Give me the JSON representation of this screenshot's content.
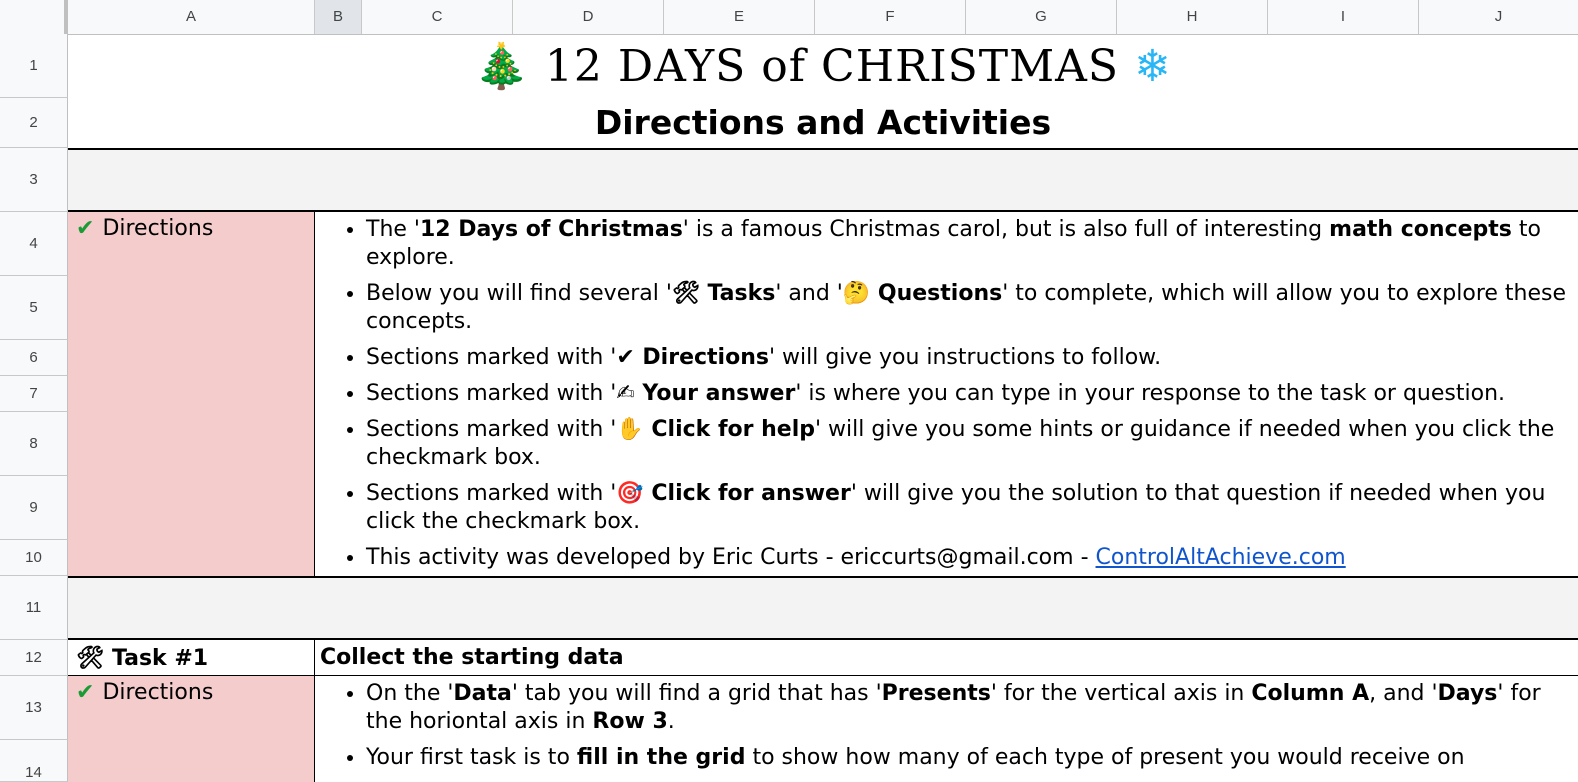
{
  "columns": [
    "A",
    "B",
    "C",
    "D",
    "E",
    "F",
    "G",
    "H",
    "I",
    "J"
  ],
  "rows": [
    "1",
    "2",
    "3",
    "4",
    "5",
    "6",
    "7",
    "8",
    "9",
    "10",
    "11",
    "12",
    "13",
    "14"
  ],
  "title": "12 DAYS of CHRISTMAS",
  "title_icon_left": "🎄",
  "title_icon_right": "❄",
  "subtitle": "Directions and Activities",
  "directions_label": "Directions",
  "check_glyph": "✔",
  "tools_glyph": "🛠",
  "directions_items": [
    {
      "parts": [
        "The '",
        "12 Days of Christmas",
        "' is a famous Christmas carol, but is also full of interesting ",
        "math concepts",
        " to explore."
      ]
    },
    {
      "parts": [
        "Below you will find several '",
        "🛠 Tasks",
        "' and '",
        "🤔 Questions",
        "' to complete, which will allow you to explore these concepts."
      ]
    },
    {
      "parts": [
        "Sections marked with '",
        "✔ Directions",
        "' will give you instructions to follow."
      ]
    },
    {
      "parts": [
        "Sections marked with '",
        "✍ Your answer",
        "' is where you can type in your response to the task or question."
      ]
    },
    {
      "parts": [
        "Sections marked with '",
        "✋ Click for help",
        "' will give you some hints or guidance if needed when you click the checkmark box."
      ]
    },
    {
      "parts": [
        "Sections marked with '",
        "🎯 Click for answer",
        "' will give you the solution to that question if needed when you click the checkmark box."
      ]
    },
    {
      "parts": [
        "This activity was developed by Eric Curts - ericcurts@gmail.com - ",
        "ControlAltAchieve.com"
      ]
    }
  ],
  "task1": {
    "label": "Task #1",
    "title": "Collect the starting data",
    "directions_label": "Directions",
    "items": [
      {
        "parts": [
          "On the '",
          "Data",
          "' tab you will find a grid that has '",
          "Presents",
          "' for the vertical axis in ",
          "Column A",
          ", and '",
          "Days",
          "' for the horiontal axis in ",
          "Row 3",
          "."
        ]
      },
      {
        "parts": [
          "Your first task is to ",
          "fill in the grid",
          " to show how many of each type of present you would receive on"
        ]
      }
    ]
  }
}
